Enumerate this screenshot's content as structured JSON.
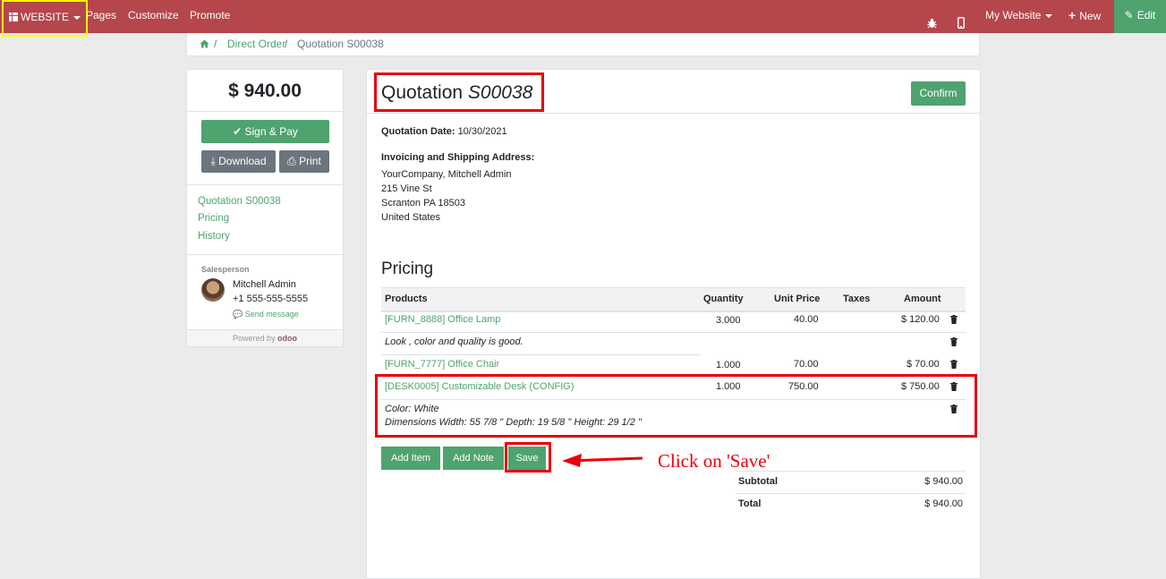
{
  "topbar": {
    "website_label": "WEBSITE",
    "pages_label": "Pages",
    "customize_label": "Customize",
    "promote_label": "Promote",
    "my_website_label": "My Website",
    "new_label": "New",
    "edit_label": "Edit",
    "bar_color": "#b5464b",
    "edit_color": "#4fa36f"
  },
  "breadcrumb": {
    "home_icon": "home-icon",
    "items": [
      "Direct Order",
      "Quotation S00038"
    ],
    "separator": "/"
  },
  "sidebar": {
    "total": "$ 940.00",
    "sign_pay_label": "Sign & Pay",
    "download_label": "Download",
    "print_label": "Print",
    "nav": [
      "Quotation S00038",
      "Pricing",
      "History"
    ],
    "salesperson_label": "Salesperson",
    "salesperson_name": "Mitchell Admin",
    "salesperson_phone": "+1 555-555-5555",
    "send_message_label": "Send message",
    "powered_by": "Powered by",
    "powered_brand": "odoo"
  },
  "quote": {
    "title_prefix": "Quotation",
    "title_number": "S00038",
    "confirm_label": "Confirm",
    "date_label": "Quotation Date:",
    "date_value": "10/30/2021",
    "address_label": "Invoicing and Shipping Address:",
    "address_lines": [
      "YourCompany, Mitchell Admin",
      "215 Vine St",
      "Scranton PA 18503",
      "United States"
    ]
  },
  "pricing": {
    "title": "Pricing",
    "headers": [
      "Products",
      "Quantity",
      "Unit Price",
      "Taxes",
      "Amount"
    ],
    "rows": [
      {
        "product": "[FURN_8888] Office Lamp",
        "quantity": "3.000",
        "unit_price": "40.00",
        "amount": "$ 120.00"
      },
      {
        "note": "Look , color and quality is good."
      },
      {
        "product": "[FURN_7777] Office Chair",
        "quantity": "1.000",
        "unit_price": "70.00",
        "amount": "$ 70.00"
      },
      {
        "product": "[DESK0005] Customizable Desk (CONFIG)",
        "quantity": "1.000",
        "unit_price": "750.00",
        "amount": "$ 750.00"
      },
      {
        "note_lines": [
          "Color: White",
          "Dimensions Width: 55 7/8 \" Depth: 19 5/8 \" Height: 29 1/2 \""
        ]
      }
    ],
    "add_item_label": "Add Item",
    "add_note_label": "Add Note",
    "save_label": "Save",
    "subtotal_label": "Subtotal",
    "subtotal_value": "$ 940.00",
    "total_label": "Total",
    "total_value": "$ 940.00"
  },
  "annotation": {
    "text": "Click on 'Save'",
    "color": "#e8000a"
  }
}
